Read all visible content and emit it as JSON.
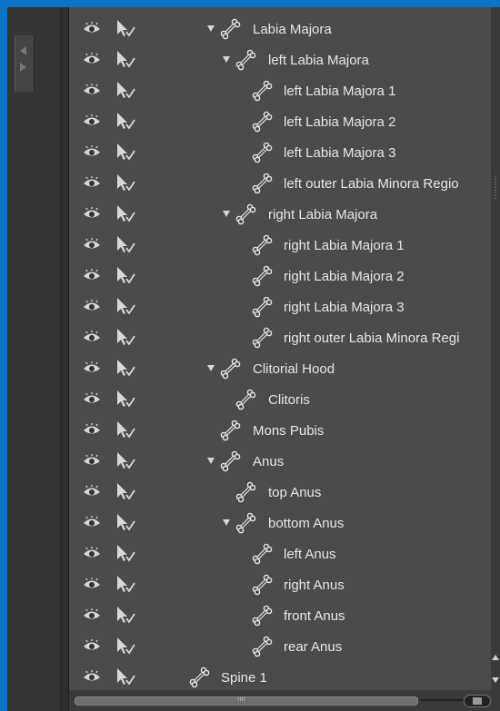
{
  "tree": {
    "rows": [
      {
        "label": "Labia Majora",
        "expanded": true
      },
      {
        "label": "left Labia Majora",
        "expanded": true
      },
      {
        "label": "left Labia Majora 1"
      },
      {
        "label": "left Labia Majora 2"
      },
      {
        "label": "left Labia Majora 3"
      },
      {
        "label": "left outer Labia Minora Regio"
      },
      {
        "label": "right Labia Majora",
        "expanded": true
      },
      {
        "label": "right Labia Majora 1"
      },
      {
        "label": "right Labia Majora 2"
      },
      {
        "label": "right Labia Majora 3"
      },
      {
        "label": "right outer Labia Minora Regi"
      },
      {
        "label": "Clitorial Hood",
        "expanded": true
      },
      {
        "label": "Clitoris"
      },
      {
        "label": "Mons Pubis"
      },
      {
        "label": "Anus",
        "expanded": true
      },
      {
        "label": "top Anus"
      },
      {
        "label": "bottom Anus",
        "expanded": true
      },
      {
        "label": "left Anus"
      },
      {
        "label": "right Anus"
      },
      {
        "label": "front Anus"
      },
      {
        "label": "rear Anus"
      },
      {
        "label": "Spine 1"
      }
    ]
  },
  "icons": {
    "visibility": "eye-icon",
    "selectable": "pointer-check-icon",
    "expand": "triangle-down-icon",
    "node": "bone-icon"
  },
  "colors": {
    "window_border": "#0b74c9",
    "panel_bg": "#4b4b4b",
    "text": "#e6e6e6"
  }
}
